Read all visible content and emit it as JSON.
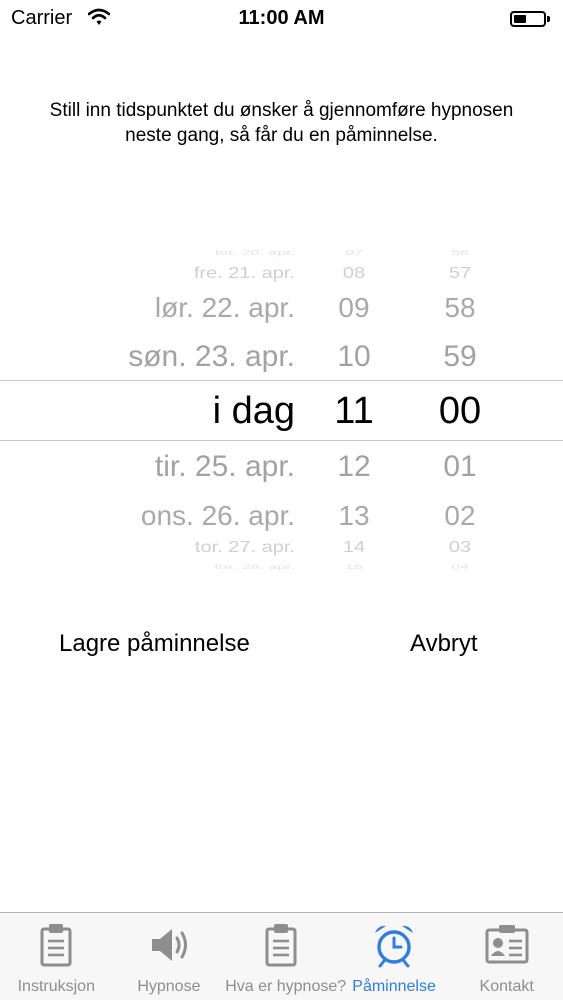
{
  "status_bar": {
    "carrier": "Carrier",
    "time": "11:00 AM"
  },
  "instruction": "Still inn tidspunktet du ønsker å gjennomføre hypnosen neste gang, så får du en påminnelse.",
  "picker": {
    "rows": [
      {
        "date": "tor. 20. apr.",
        "hour": "07",
        "minute": "56"
      },
      {
        "date": "fre. 21. apr.",
        "hour": "08",
        "minute": "57"
      },
      {
        "date": "lør. 22. apr.",
        "hour": "09",
        "minute": "58"
      },
      {
        "date": "søn. 23. apr.",
        "hour": "10",
        "minute": "59"
      },
      {
        "date": "i dag",
        "hour": "11",
        "minute": "00"
      },
      {
        "date": "tir. 25. apr.",
        "hour": "12",
        "minute": "01"
      },
      {
        "date": "ons. 26. apr.",
        "hour": "13",
        "minute": "02"
      },
      {
        "date": "tor. 27. apr.",
        "hour": "14",
        "minute": "03"
      },
      {
        "date": "fre. 28. apr.",
        "hour": "15",
        "minute": "04"
      }
    ],
    "selected_index": 4
  },
  "actions": {
    "save_label": "Lagre påminnelse",
    "cancel_label": "Avbryt"
  },
  "tabbar": {
    "tabs": [
      {
        "label": "Instruksjon",
        "icon": "clipboard-icon"
      },
      {
        "label": "Hypnose",
        "icon": "speaker-icon"
      },
      {
        "label": "Hva er hypnose?",
        "icon": "clipboard-icon"
      },
      {
        "label": "Påminnelse",
        "icon": "alarm-clock-icon"
      },
      {
        "label": "Kontakt",
        "icon": "contact-card-icon"
      }
    ],
    "active_index": 3
  },
  "colors": {
    "accent": "#2f7de1",
    "inactive": "#8e8e8e",
    "tabbar_bg": "#f7f7f7"
  }
}
